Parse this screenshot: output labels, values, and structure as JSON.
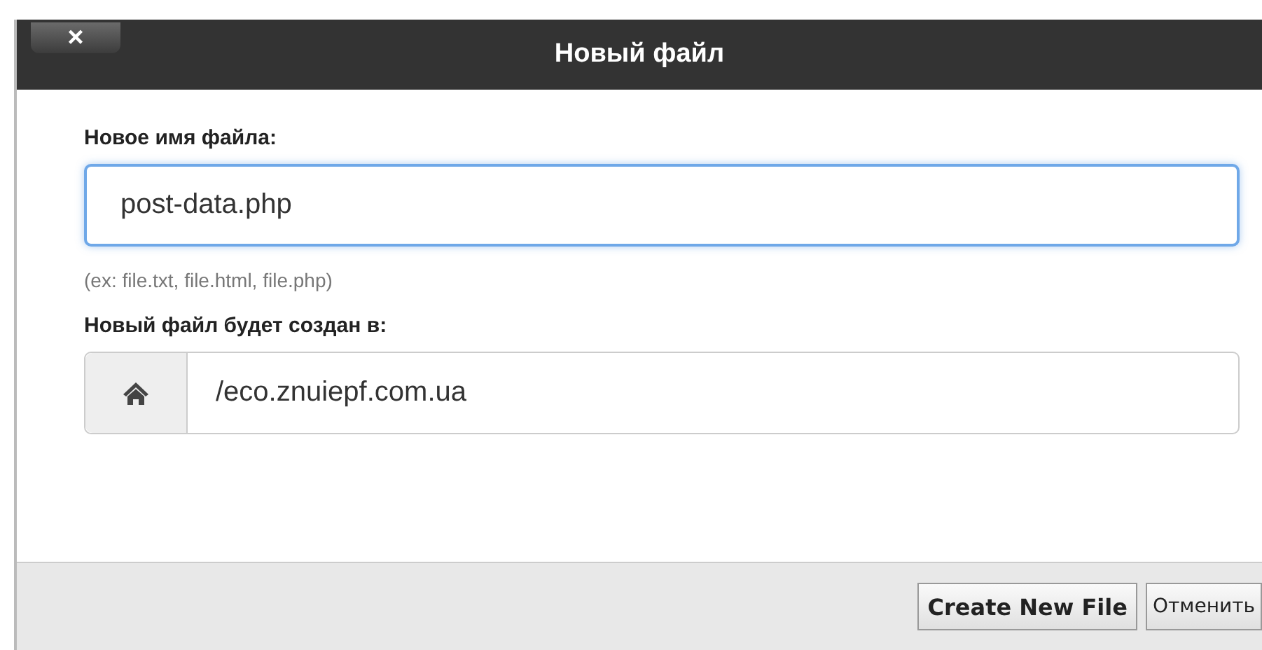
{
  "window": {
    "title": "Новый файл",
    "close": "×"
  },
  "fields": [
    {
      "label": "Новое имя файла:",
      "value": "post-data.php",
      "focused": true,
      "hint": "(ex: file.txt, file.html, file.php)"
    },
    {
      "label": "Новый файл будет создан в:",
      "value": "/eco.znuiepf.com.ua",
      "focused": false
    }
  ],
  "buttons": [
    {
      "label": "Create New File",
      "kind": "primary"
    },
    {
      "label": "Отменить",
      "kind": "secondary"
    }
  ]
}
